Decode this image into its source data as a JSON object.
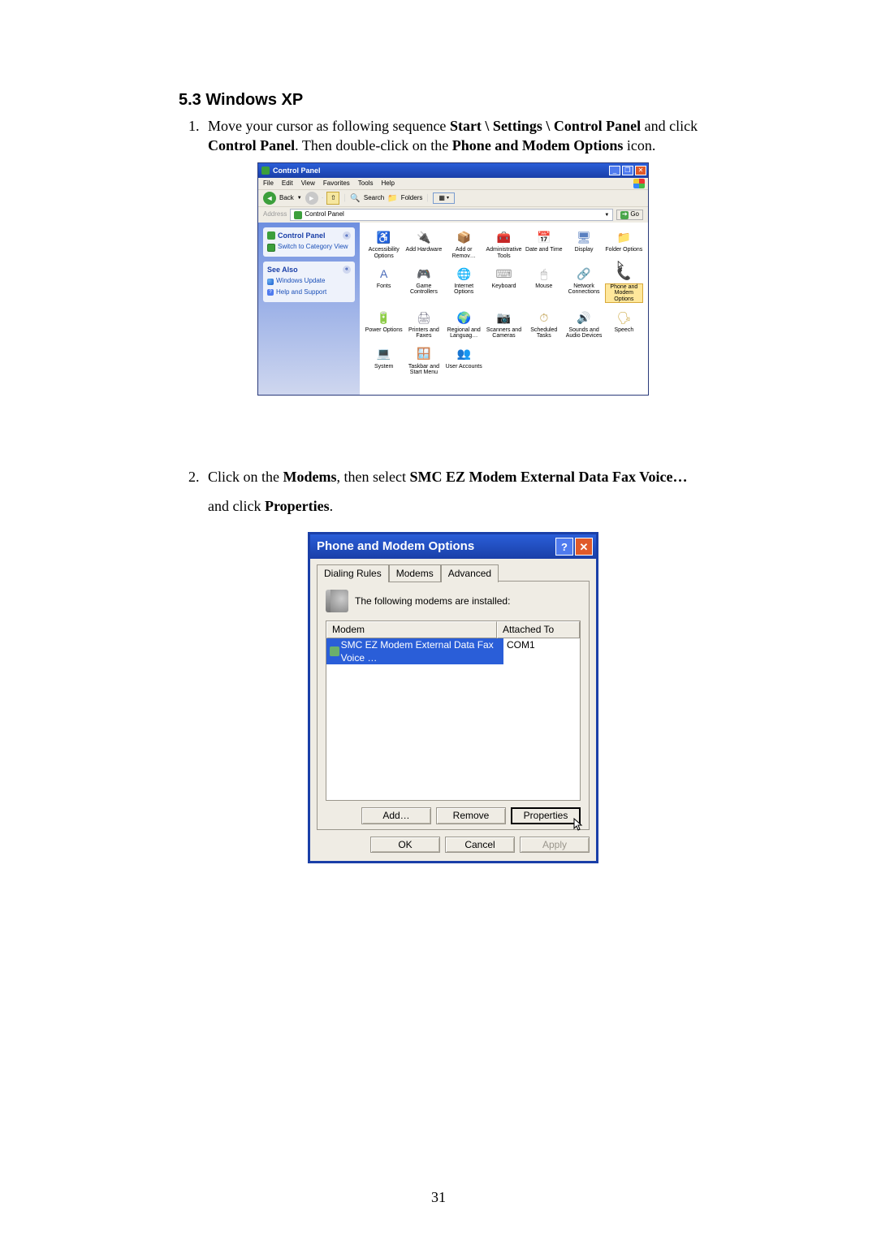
{
  "heading": "5.3 Windows XP",
  "step1": {
    "pre": "Move your cursor as following sequence ",
    "b1": "Start \\ Settings \\ Control Panel",
    "mid1": " and click ",
    "b2": "Control Panel",
    "mid2": ". Then double-click on the ",
    "b3": "Phone and Modem Options",
    "post": " icon."
  },
  "step2": {
    "pre": "Click on the ",
    "b1": "Modems",
    "mid1": ", then select ",
    "b2": "SMC EZ Modem External Data Fax Voice…",
    "mid2": " and click ",
    "b3": "Properties",
    "post": "."
  },
  "page_number": "31",
  "cp": {
    "title": "Control Panel",
    "menubar": [
      "File",
      "Edit",
      "View",
      "Favorites",
      "Tools",
      "Help"
    ],
    "toolbar": {
      "back": "Back",
      "search": "Search",
      "folders": "Folders"
    },
    "address_label": "Address",
    "address_value": "Control Panel",
    "go": "Go",
    "sidebar": {
      "panel1_title": "Control Panel",
      "switch_view": "Switch to Category View",
      "panel2_title": "See Also",
      "windows_update": "Windows Update",
      "help_support": "Help and Support"
    },
    "items": [
      {
        "label": "Accessibility Options",
        "glyph": "♿",
        "c": "#3c9f3c"
      },
      {
        "label": "Add Hardware",
        "glyph": "🔌",
        "c": "#5a7ac0"
      },
      {
        "label": "Add or Remov…",
        "glyph": "📦",
        "c": "#c8a060"
      },
      {
        "label": "Administrative Tools",
        "glyph": "🧰",
        "c": "#6a6a9a"
      },
      {
        "label": "Date and Time",
        "glyph": "📅",
        "c": "#6aa06a"
      },
      {
        "label": "Display",
        "glyph": "🖥",
        "c": "#5a80c0"
      },
      {
        "label": "Folder Options",
        "glyph": "📁",
        "c": "#d8b050"
      },
      {
        "label": "Fonts",
        "glyph": "A",
        "c": "#4a6ab8"
      },
      {
        "label": "Game Controllers",
        "glyph": "🎮",
        "c": "#808080"
      },
      {
        "label": "Internet Options",
        "glyph": "🌐",
        "c": "#3a70c0"
      },
      {
        "label": "Keyboard",
        "glyph": "⌨",
        "c": "#9a9a9a"
      },
      {
        "label": "Mouse",
        "glyph": "🖱",
        "c": "#a0a0a0"
      },
      {
        "label": "Network Connections",
        "glyph": "🔗",
        "c": "#4a8ac0"
      },
      {
        "label": "Phone and Modem Options",
        "glyph": "📞",
        "c": "#d08a3a",
        "hl": true
      },
      {
        "label": "Power Options",
        "glyph": "🔋",
        "c": "#6aa06a"
      },
      {
        "label": "Printers and Faxes",
        "glyph": "🖨",
        "c": "#808090"
      },
      {
        "label": "Regional and Languag…",
        "glyph": "🌍",
        "c": "#4a90c0"
      },
      {
        "label": "Scanners and Cameras",
        "glyph": "📷",
        "c": "#8a8a8a"
      },
      {
        "label": "Scheduled Tasks",
        "glyph": "⏱",
        "c": "#c0a050"
      },
      {
        "label": "Sounds and Audio Devices",
        "glyph": "🔊",
        "c": "#808080"
      },
      {
        "label": "Speech",
        "glyph": "🗣",
        "c": "#c8a030"
      },
      {
        "label": "System",
        "glyph": "💻",
        "c": "#6a88c0"
      },
      {
        "label": "Taskbar and Start Menu",
        "glyph": "🪟",
        "c": "#3a70c0"
      },
      {
        "label": "User Accounts",
        "glyph": "👥",
        "c": "#c86a3a"
      }
    ]
  },
  "dlg": {
    "title": "Phone and Modem Options",
    "tabs": [
      "Dialing Rules",
      "Modems",
      "Advanced"
    ],
    "active_tab": 1,
    "instruction": "The following modems are installed:",
    "col_modem": "Modem",
    "col_attached": "Attached To",
    "row_modem": "SMC EZ Modem External Data Fax Voice …",
    "row_attached": "COM1",
    "btn_add": "Add…",
    "btn_remove": "Remove",
    "btn_properties": "Properties",
    "btn_ok": "OK",
    "btn_cancel": "Cancel",
    "btn_apply": "Apply"
  }
}
